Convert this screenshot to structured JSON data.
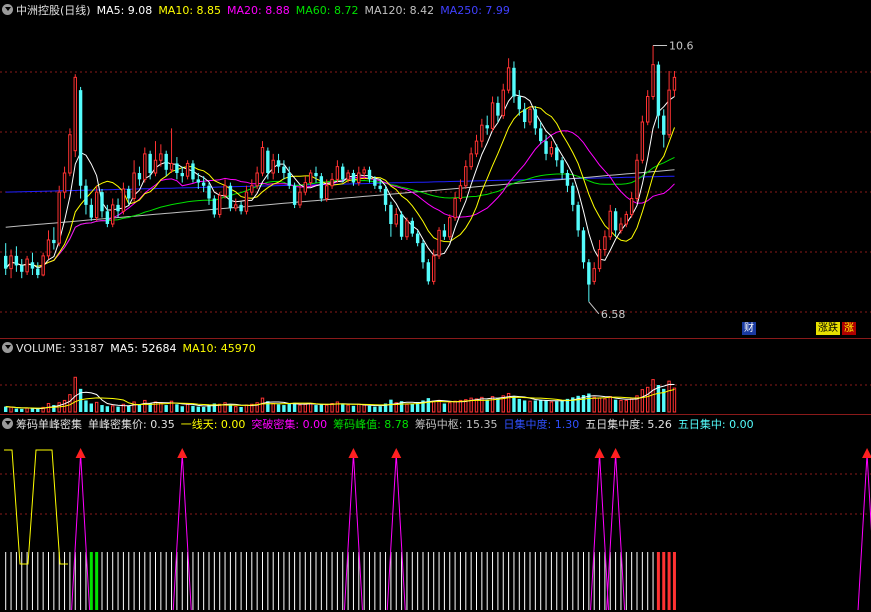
{
  "price_pane": {
    "stock_name": "中洲控股(日线)",
    "ma5_label": "MA5: 9.08",
    "ma10_label": "MA10: 8.85",
    "ma20_label": "MA20: 8.88",
    "ma60_label": "MA60: 8.72",
    "ma120_label": "MA120: 8.42",
    "ma250_label": "MA250: 7.99",
    "high_marker": "10.6",
    "low_marker": "6.58",
    "badge_cai": "财",
    "badge_zhangdie": "涨跌",
    "badge_zhang": "涨"
  },
  "volume_pane": {
    "volume_label": "VOLUME: 33187",
    "ma5_label": "MA5: 52684",
    "ma10_label": "MA10: 45970"
  },
  "indicator_pane": {
    "name": "筹码单峰密集",
    "single_peak_price": "单峰密集价: 0.35",
    "one_line_sky": "一线天: 0.00",
    "breakthrough": "突破密集: 0.00",
    "peak_value": "筹码峰值: 8.78",
    "center": "筹码中枢: 15.35",
    "daily_concentration": "日集中度: 1.30",
    "five_day_concentration": "五日集中度: 5.26",
    "five_day_concentrated": "五日集中: 0.00"
  },
  "colors": {
    "up": "#ff3232",
    "down": "#54fcfc",
    "ma5": "#ffffff",
    "ma10": "#ffff00",
    "ma20": "#ff00ff",
    "ma60": "#00e000",
    "ma120": "#c0c0c0",
    "ma250": "#2020ff",
    "grid": "#8a1a1a"
  },
  "chart_data": {
    "type": "candlestick",
    "y_range": [
      6.2,
      11.0
    ],
    "max_price": 10.6,
    "min_price": 6.58,
    "candles": [
      [
        7.3,
        7.1,
        7.5,
        7.0
      ],
      [
        7.1,
        7.3,
        7.4,
        6.95
      ],
      [
        7.3,
        7.15,
        7.45,
        7.05
      ],
      [
        7.15,
        7.05,
        7.25,
        6.95
      ],
      [
        7.05,
        7.25,
        7.3,
        7.0
      ],
      [
        7.2,
        7.1,
        7.35,
        7.0
      ],
      [
        7.1,
        7.0,
        7.2,
        6.95
      ],
      [
        7.0,
        7.3,
        7.35,
        6.98
      ],
      [
        7.3,
        7.55,
        7.7,
        7.25
      ],
      [
        7.55,
        7.5,
        7.75,
        7.4
      ],
      [
        7.5,
        8.3,
        8.4,
        7.45
      ],
      [
        8.3,
        8.6,
        8.7,
        8.2
      ],
      [
        8.6,
        9.2,
        9.3,
        8.55
      ],
      [
        8.95,
        10.1,
        10.15,
        8.85
      ],
      [
        9.9,
        8.4,
        9.95,
        8.2
      ],
      [
        8.4,
        8.1,
        8.5,
        7.95
      ],
      [
        8.1,
        7.9,
        8.2,
        7.85
      ],
      [
        7.9,
        8.3,
        8.4,
        7.85
      ],
      [
        8.3,
        8.0,
        8.35,
        7.9
      ],
      [
        8.0,
        7.8,
        8.1,
        7.75
      ],
      [
        7.8,
        8.1,
        8.2,
        7.75
      ],
      [
        8.1,
        8.0,
        8.2,
        7.9
      ],
      [
        8.0,
        8.35,
        8.45,
        7.95
      ],
      [
        8.35,
        8.2,
        8.4,
        8.1
      ],
      [
        8.2,
        8.6,
        8.8,
        8.15
      ],
      [
        8.6,
        8.5,
        8.7,
        8.4
      ],
      [
        8.5,
        8.9,
        9.0,
        8.45
      ],
      [
        8.9,
        8.6,
        8.95,
        8.5
      ],
      [
        8.6,
        8.8,
        9.1,
        8.55
      ],
      [
        8.8,
        8.9,
        9.05,
        8.7
      ],
      [
        8.9,
        8.65,
        8.95,
        8.55
      ],
      [
        8.65,
        8.75,
        9.3,
        8.6
      ],
      [
        8.75,
        8.6,
        8.85,
        8.5
      ],
      [
        8.6,
        8.55,
        8.7,
        8.45
      ],
      [
        8.55,
        8.75,
        8.8,
        8.5
      ],
      [
        8.75,
        8.5,
        8.8,
        8.45
      ],
      [
        8.5,
        8.45,
        8.6,
        8.35
      ],
      [
        8.45,
        8.4,
        8.55,
        8.3
      ],
      [
        8.4,
        8.2,
        8.45,
        8.1
      ],
      [
        8.2,
        7.95,
        8.25,
        7.9
      ],
      [
        7.95,
        8.25,
        8.3,
        7.9
      ],
      [
        8.25,
        8.4,
        8.5,
        8.2
      ],
      [
        8.4,
        8.05,
        8.45,
        8.0
      ],
      [
        8.05,
        8.1,
        8.2,
        8.0
      ],
      [
        8.1,
        8.0,
        8.15,
        7.95
      ],
      [
        8.0,
        8.3,
        8.4,
        7.95
      ],
      [
        8.3,
        8.4,
        8.5,
        8.25
      ],
      [
        8.4,
        8.6,
        8.7,
        8.35
      ],
      [
        8.6,
        9.0,
        9.1,
        8.55
      ],
      [
        8.95,
        8.6,
        9.0,
        8.5
      ],
      [
        8.6,
        8.8,
        8.9,
        8.5
      ],
      [
        8.8,
        8.7,
        8.9,
        8.6
      ],
      [
        8.7,
        8.6,
        8.8,
        8.5
      ],
      [
        8.6,
        8.4,
        8.7,
        8.35
      ],
      [
        8.4,
        8.1,
        8.45,
        8.05
      ],
      [
        8.1,
        8.3,
        8.4,
        8.05
      ],
      [
        8.3,
        8.45,
        8.55,
        8.25
      ],
      [
        8.45,
        8.6,
        8.65,
        8.4
      ],
      [
        8.6,
        8.55,
        8.7,
        8.45
      ],
      [
        8.55,
        8.2,
        8.6,
        8.15
      ],
      [
        8.2,
        8.4,
        8.5,
        8.15
      ],
      [
        8.4,
        8.5,
        8.6,
        8.35
      ],
      [
        8.5,
        8.7,
        8.8,
        8.45
      ],
      [
        8.7,
        8.5,
        8.75,
        8.45
      ],
      [
        8.5,
        8.6,
        8.65,
        8.45
      ],
      [
        8.6,
        8.45,
        8.65,
        8.4
      ],
      [
        8.45,
        8.6,
        8.7,
        8.4
      ],
      [
        8.6,
        8.65,
        8.7,
        8.5
      ],
      [
        8.65,
        8.5,
        8.7,
        8.45
      ],
      [
        8.5,
        8.4,
        8.55,
        8.35
      ],
      [
        8.4,
        8.35,
        8.5,
        8.3
      ],
      [
        8.35,
        8.1,
        8.4,
        8.0
      ],
      [
        8.1,
        7.8,
        8.15,
        7.6
      ],
      [
        7.8,
        7.95,
        8.05,
        7.75
      ],
      [
        7.95,
        7.6,
        8.0,
        7.55
      ],
      [
        7.6,
        7.85,
        7.9,
        7.55
      ],
      [
        7.85,
        7.65,
        7.9,
        7.6
      ],
      [
        7.65,
        7.5,
        7.7,
        7.45
      ],
      [
        7.5,
        7.2,
        7.55,
        7.1
      ],
      [
        7.2,
        6.9,
        7.25,
        6.85
      ],
      [
        6.9,
        7.3,
        7.4,
        6.85
      ],
      [
        7.3,
        7.7,
        7.75,
        7.25
      ],
      [
        7.7,
        7.6,
        7.8,
        7.55
      ],
      [
        7.6,
        7.9,
        7.95,
        7.55
      ],
      [
        7.9,
        8.2,
        8.3,
        7.85
      ],
      [
        8.2,
        8.4,
        8.5,
        8.15
      ],
      [
        8.4,
        8.7,
        8.8,
        8.35
      ],
      [
        8.7,
        8.9,
        9.0,
        8.65
      ],
      [
        8.9,
        9.1,
        9.2,
        8.85
      ],
      [
        9.1,
        9.35,
        9.45,
        9.0
      ],
      [
        9.35,
        9.3,
        9.5,
        9.2
      ],
      [
        9.3,
        9.7,
        9.8,
        9.25
      ],
      [
        9.7,
        9.5,
        9.8,
        9.4
      ],
      [
        9.5,
        9.9,
        10.0,
        9.45
      ],
      [
        9.9,
        10.25,
        10.4,
        9.85
      ],
      [
        10.25,
        9.8,
        10.35,
        9.7
      ],
      [
        9.8,
        9.6,
        9.9,
        9.5
      ],
      [
        9.6,
        9.4,
        9.7,
        9.3
      ],
      [
        9.4,
        9.6,
        9.65,
        9.35
      ],
      [
        9.6,
        9.3,
        9.65,
        9.2
      ],
      [
        9.3,
        9.1,
        9.4,
        9.05
      ],
      [
        9.1,
        8.9,
        9.2,
        8.8
      ],
      [
        8.9,
        9.0,
        9.1,
        8.85
      ],
      [
        9.0,
        8.8,
        9.05,
        8.7
      ],
      [
        8.8,
        8.6,
        8.85,
        8.5
      ],
      [
        8.6,
        8.4,
        8.65,
        8.3
      ],
      [
        8.4,
        8.1,
        8.45,
        8.0
      ],
      [
        8.1,
        7.7,
        8.15,
        7.6
      ],
      [
        7.7,
        7.2,
        7.75,
        7.1
      ],
      [
        7.2,
        6.85,
        7.25,
        6.58
      ],
      [
        6.9,
        7.1,
        7.2,
        6.85
      ],
      [
        7.1,
        7.4,
        7.55,
        7.05
      ],
      [
        7.4,
        7.6,
        7.7,
        7.3
      ],
      [
        7.6,
        8.0,
        8.1,
        7.55
      ],
      [
        8.0,
        7.7,
        8.05,
        7.6
      ],
      [
        7.7,
        7.8,
        7.9,
        7.65
      ],
      [
        7.8,
        7.95,
        8.0,
        7.75
      ],
      [
        7.95,
        8.2,
        8.3,
        7.9
      ],
      [
        8.2,
        8.8,
        8.9,
        8.15
      ],
      [
        8.8,
        9.4,
        9.5,
        8.75
      ],
      [
        9.4,
        9.8,
        9.9,
        9.35
      ],
      [
        9.8,
        10.3,
        10.6,
        9.75
      ],
      [
        10.3,
        9.5,
        10.35,
        9.3
      ],
      [
        9.5,
        9.2,
        9.6,
        9.0
      ],
      [
        9.2,
        9.9,
        10.2,
        9.15
      ],
      [
        9.9,
        10.1,
        10.2,
        9.8
      ]
    ],
    "volume_max": 140000,
    "volumes": [
      14000,
      12000,
      9000,
      8000,
      10000,
      9000,
      8000,
      12000,
      22000,
      18000,
      24000,
      30000,
      45000,
      90000,
      60000,
      30000,
      22000,
      25000,
      18000,
      15000,
      16000,
      14000,
      20000,
      16000,
      26000,
      20000,
      30000,
      22000,
      26000,
      24000,
      18000,
      28000,
      20000,
      15000,
      20000,
      16000,
      14000,
      13000,
      18000,
      22000,
      20000,
      24000,
      18000,
      14000,
      13000,
      18000,
      20000,
      24000,
      36000,
      28000,
      22000,
      20000,
      18000,
      22000,
      24000,
      18000,
      20000,
      22000,
      18000,
      20000,
      18000,
      22000,
      26000,
      20000,
      18000,
      16000,
      20000,
      18000,
      16000,
      14000,
      15000,
      22000,
      32000,
      24000,
      28000,
      20000,
      22000,
      26000,
      30000,
      36000,
      28000,
      30000,
      22000,
      24000,
      28000,
      30000,
      32000,
      36000,
      34000,
      38000,
      32000,
      40000,
      36000,
      42000,
      48000,
      40000,
      34000,
      30000,
      28000,
      30000,
      32000,
      30000,
      26000,
      28000,
      30000,
      34000,
      38000,
      42000,
      44000,
      48000,
      38000,
      36000,
      34000,
      40000,
      32000,
      30000,
      30000,
      34000,
      42000,
      58000,
      64000,
      84000,
      70000,
      60000,
      80000,
      62000
    ],
    "signal_peaks": [
      14,
      33,
      65,
      73,
      111,
      114,
      161
    ],
    "bar_series": [
      {
        "color": "#00e000",
        "indices": [
          16,
          17,
          151
        ]
      },
      {
        "color": "#ffff00",
        "indices": [
          128,
          166,
          168
        ]
      },
      {
        "color": "#ff3232",
        "indices": [
          122,
          123,
          124,
          125,
          126,
          127,
          129,
          130,
          131,
          132,
          133,
          134,
          160,
          161,
          162,
          163,
          164,
          165,
          167,
          169,
          170
        ]
      }
    ]
  }
}
